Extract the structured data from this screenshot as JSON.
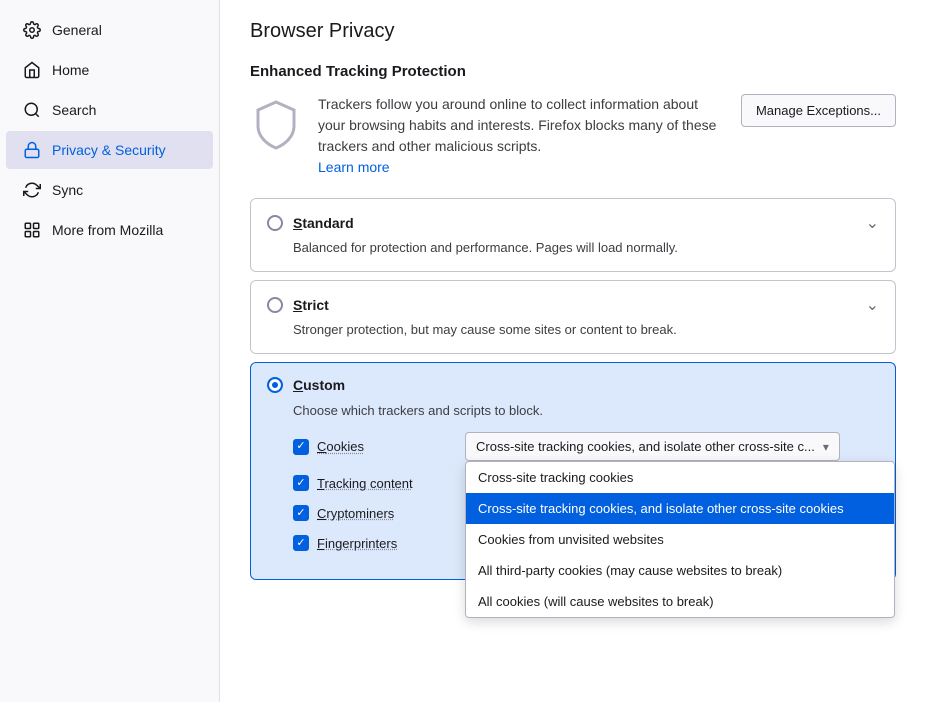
{
  "sidebar": {
    "items": [
      {
        "id": "general",
        "label": "General",
        "icon": "gear"
      },
      {
        "id": "home",
        "label": "Home",
        "icon": "home"
      },
      {
        "id": "search",
        "label": "Search",
        "icon": "search"
      },
      {
        "id": "privacy",
        "label": "Privacy & Security",
        "icon": "lock",
        "active": true
      },
      {
        "id": "sync",
        "label": "Sync",
        "icon": "sync"
      },
      {
        "id": "mozilla",
        "label": "More from Mozilla",
        "icon": "mozilla"
      }
    ]
  },
  "main": {
    "page_title": "Browser Privacy",
    "section_title": "Enhanced Tracking Protection",
    "etp_description": "Trackers follow you around online to collect information about your browsing habits and interests. Firefox blocks many of these trackers and other malicious scripts.",
    "learn_more": "Learn more",
    "manage_btn": "Manage Exceptions...",
    "options": [
      {
        "id": "standard",
        "label": "Standard",
        "desc": "Balanced for protection and performance. Pages will load normally.",
        "checked": false
      },
      {
        "id": "strict",
        "label": "Strict",
        "desc": "Stronger protection, but may cause some sites or content to break.",
        "checked": false
      },
      {
        "id": "custom",
        "label": "Custom",
        "desc": "Choose which trackers and scripts to block.",
        "checked": true
      }
    ],
    "custom": {
      "rows": [
        {
          "id": "cookies",
          "label": "Cookies",
          "checked": true,
          "dropdown_value": "Cross-site tracking cookies, and isolate other cross-site c...",
          "dropdown_options": [
            {
              "label": "Cross-site tracking cookies",
              "selected": false
            },
            {
              "label": "Cross-site tracking cookies, and isolate other cross-site cookies",
              "selected": true
            },
            {
              "label": "Cookies from unvisited websites",
              "selected": false
            },
            {
              "label": "All third-party cookies (may cause websites to break)",
              "selected": false
            },
            {
              "label": "All cookies (will cause websites to break)",
              "selected": false
            }
          ]
        },
        {
          "id": "tracking_content",
          "label": "Tracking content",
          "checked": true
        },
        {
          "id": "cryptominers",
          "label": "Cryptominers",
          "checked": true
        },
        {
          "id": "fingerprinters",
          "label": "Fingerprinters",
          "checked": true
        }
      ]
    }
  }
}
